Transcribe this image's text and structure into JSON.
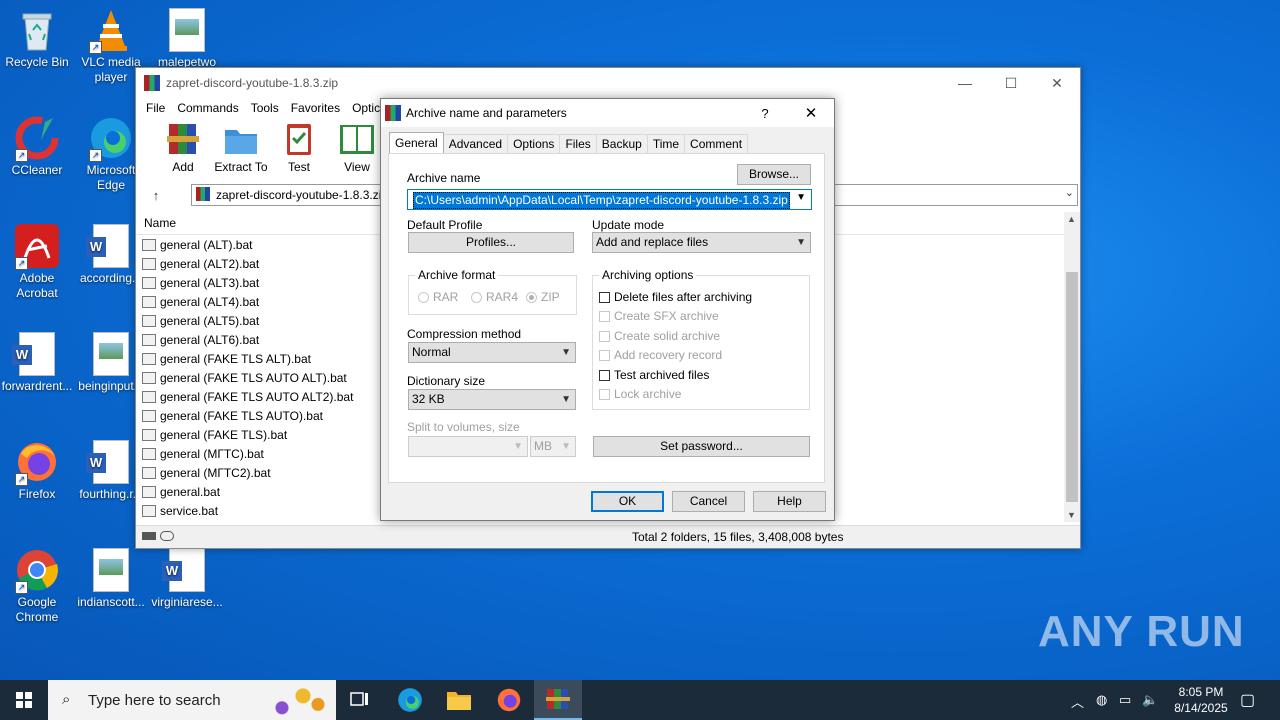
{
  "desktop": {
    "icons": [
      {
        "label": "Recycle Bin",
        "icon": "recycle-bin-icon"
      },
      {
        "label": "VLC media player",
        "icon": "vlc-icon"
      },
      {
        "label": "malepetwo",
        "icon": "image-file-icon"
      },
      {
        "label": "CCleaner",
        "icon": "ccleaner-icon"
      },
      {
        "label": "Microsoft Edge",
        "icon": "edge-icon"
      },
      {
        "label": "Adobe Acrobat",
        "icon": "acrobat-icon"
      },
      {
        "label": "according...",
        "icon": "word-doc-icon"
      },
      {
        "label": "forwardrent...",
        "icon": "word-doc-icon"
      },
      {
        "label": "beinginput...",
        "icon": "image-file-icon"
      },
      {
        "label": "Firefox",
        "icon": "firefox-icon"
      },
      {
        "label": "fourthing.r...",
        "icon": "word-doc-icon"
      },
      {
        "label": "Google Chrome",
        "icon": "chrome-icon"
      },
      {
        "label": "indianscott...",
        "icon": "image-file-icon"
      },
      {
        "label": "virginiarese...",
        "icon": "word-doc-icon"
      }
    ],
    "watermark": "ANY RUN"
  },
  "main_window": {
    "title": "zapret-discord-youtube-1.8.3.zip",
    "menu": [
      "File",
      "Commands",
      "Tools",
      "Favorites",
      "Optic"
    ],
    "toolbar": [
      {
        "label": "Add",
        "icon": "add-archive-icon"
      },
      {
        "label": "Extract To",
        "icon": "extract-folder-icon"
      },
      {
        "label": "Test",
        "icon": "test-clipboard-icon"
      },
      {
        "label": "View",
        "icon": "view-book-icon"
      }
    ],
    "address": "zapret-discord-youtube-1.8.3.zi",
    "column_name": "Name",
    "files": [
      "general (ALT).bat",
      "general (ALT2).bat",
      "general (ALT3).bat",
      "general (ALT4).bat",
      "general (ALT5).bat",
      "general (ALT6).bat",
      "general (FAKE TLS ALT).bat",
      "general (FAKE TLS AUTO ALT).bat",
      "general (FAKE TLS AUTO ALT2).bat",
      "general (FAKE TLS AUTO).bat",
      "general (FAKE TLS).bat",
      "general (МГТС).bat",
      "general (МГТС2).bat",
      "general.bat",
      "service.bat"
    ],
    "status": "Total 2 folders, 15 files, 3,408,008 bytes"
  },
  "dialog": {
    "title": "Archive name and parameters",
    "help_glyph": "?",
    "close_glyph": "✕",
    "tabs": [
      "General",
      "Advanced",
      "Options",
      "Files",
      "Backup",
      "Time",
      "Comment"
    ],
    "active_tab": "General",
    "archive_name_label": "Archive name",
    "browse_button": "Browse...",
    "archive_name_value": "C:\\Users\\admin\\AppData\\Local\\Temp\\zapret-discord-youtube-1.8.3.zip",
    "default_profile_label": "Default Profile",
    "profiles_button": "Profiles...",
    "update_mode_label": "Update mode",
    "update_mode_value": "Add and replace files",
    "archive_format_label": "Archive format",
    "formats": [
      {
        "label": "RAR",
        "selected": false
      },
      {
        "label": "RAR4",
        "selected": false
      },
      {
        "label": "ZIP",
        "selected": true
      }
    ],
    "archiving_options_label": "Archiving options",
    "options": [
      {
        "label": "Delete files after archiving",
        "enabled": true,
        "checked": false
      },
      {
        "label": "Create SFX archive",
        "enabled": false,
        "checked": false
      },
      {
        "label": "Create solid archive",
        "enabled": false,
        "checked": false
      },
      {
        "label": "Add recovery record",
        "enabled": false,
        "checked": false
      },
      {
        "label": "Test archived files",
        "enabled": true,
        "checked": false
      },
      {
        "label": "Lock archive",
        "enabled": false,
        "checked": false
      }
    ],
    "compression_method_label": "Compression method",
    "compression_method_value": "Normal",
    "dictionary_size_label": "Dictionary size",
    "dictionary_size_value": "32 KB",
    "split_label": "Split to volumes, size",
    "split_unit": "MB",
    "set_password_button": "Set password...",
    "ok_button": "OK",
    "cancel_button": "Cancel",
    "help_button": "Help"
  },
  "taskbar": {
    "search_placeholder": "Type here to search",
    "time": "8:05 PM",
    "date": "8/14/2025"
  }
}
